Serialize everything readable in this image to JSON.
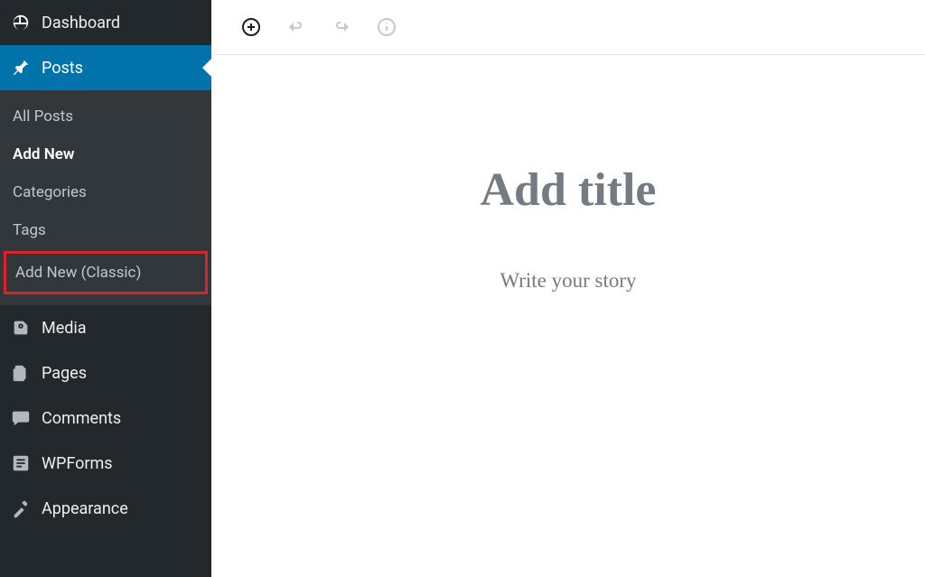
{
  "sidebar": {
    "dashboard": "Dashboard",
    "posts": "Posts",
    "submenu": {
      "all_posts": "All Posts",
      "add_new": "Add New",
      "categories": "Categories",
      "tags": "Tags",
      "add_new_classic": "Add New (Classic)"
    },
    "media": "Media",
    "pages": "Pages",
    "comments": "Comments",
    "wpforms": "WPForms",
    "appearance": "Appearance"
  },
  "editor": {
    "title_placeholder": "Add title",
    "body_placeholder": "Write your story"
  }
}
